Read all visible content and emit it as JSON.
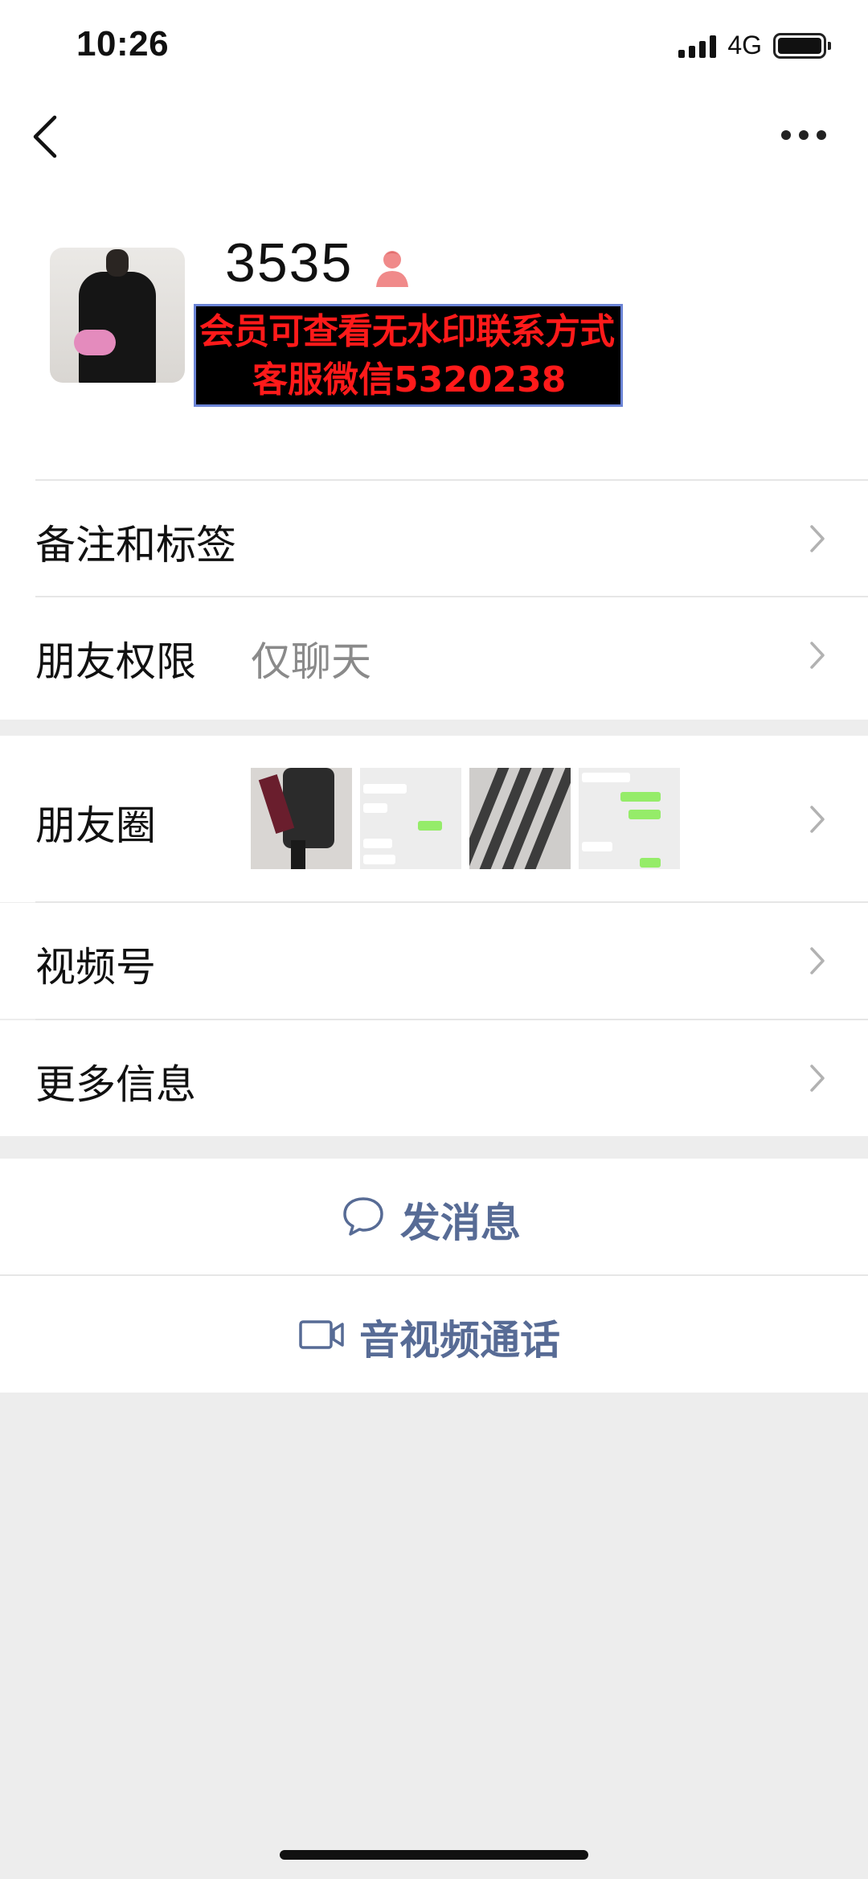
{
  "status_bar": {
    "time": "10:26",
    "network": "4G",
    "battery_level": 1.0
  },
  "nav": {
    "back_icon": "chevron-left-icon",
    "more_icon": "more-dots-icon"
  },
  "profile": {
    "nickname": "3535",
    "gender_icon": "female-person-icon",
    "gender_color": "#f08a8a",
    "watermark": {
      "line1": "会员可查看无水印联系方式",
      "line2": "客服微信5320238",
      "text_color": "#ff1a1a"
    }
  },
  "cells": {
    "remarks": {
      "label": "备注和标签"
    },
    "permissions": {
      "label": "朋友权限",
      "value": "仅聊天"
    },
    "moments": {
      "label": "朋友圈"
    },
    "channels": {
      "label": "视频号"
    },
    "more_info": {
      "label": "更多信息"
    }
  },
  "actions": {
    "message": {
      "label": "发消息",
      "icon": "chat-bubble-icon"
    },
    "call": {
      "label": "音视频通话",
      "icon": "video-camera-icon"
    }
  },
  "colors": {
    "link": "#576b95",
    "background": "#ededed",
    "chevron": "#b2b2b2"
  }
}
